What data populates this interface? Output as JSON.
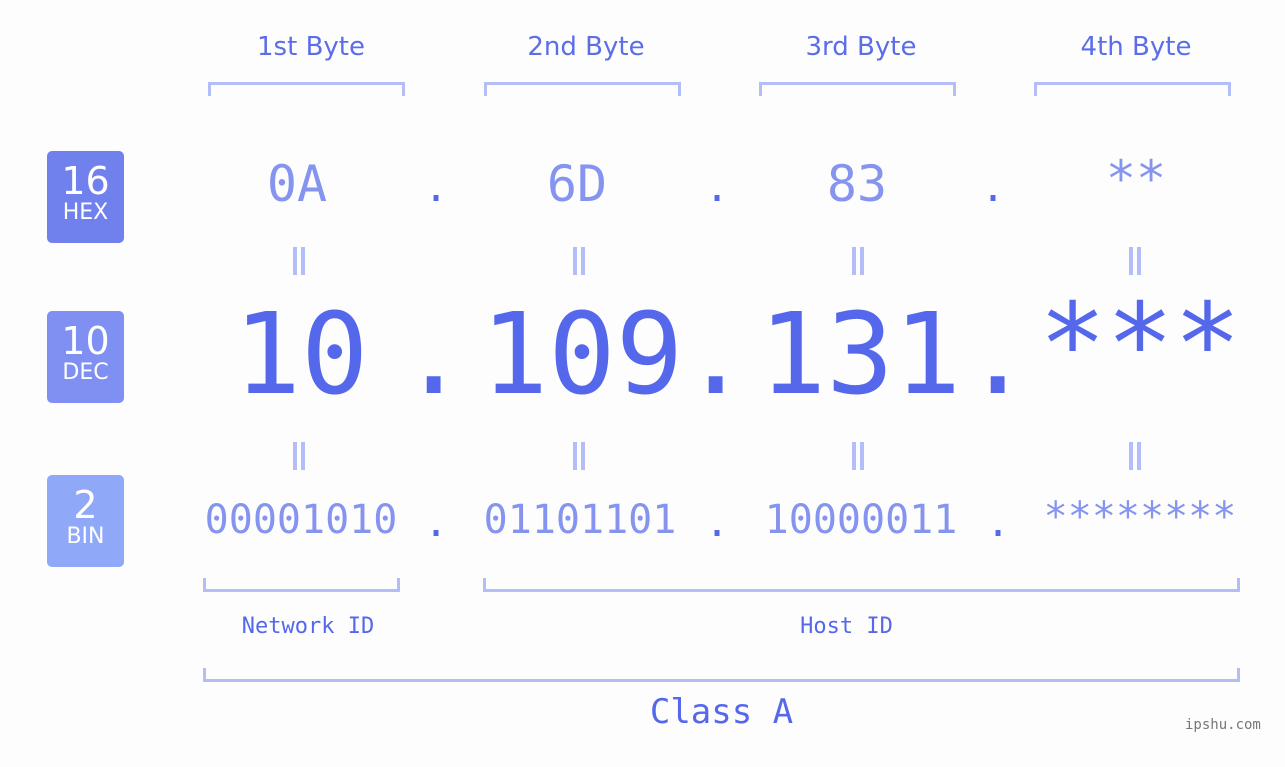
{
  "header": {
    "bytes": [
      "1st Byte",
      "2nd Byte",
      "3rd Byte",
      "4th Byte"
    ]
  },
  "badges": [
    {
      "base": "16",
      "name": "HEX",
      "color": "#7080ec"
    },
    {
      "base": "10",
      "name": "DEC",
      "color": "#8090f2"
    },
    {
      "base": "2",
      "name": "BIN",
      "color": "#90a8f8"
    }
  ],
  "hex": [
    "0A",
    "6D",
    "83",
    "**"
  ],
  "dec": [
    "10",
    "109",
    "131",
    "***"
  ],
  "bin": [
    "00001010",
    "01101101",
    "10000011",
    "********"
  ],
  "separator": ".",
  "segments": {
    "network": "Network ID",
    "host": "Host ID",
    "class": "Class A"
  },
  "watermark": "ipshu.com",
  "colors": {
    "accent": "#5568ec",
    "light": "#8594ee",
    "bracket": "#b3bdf7"
  }
}
